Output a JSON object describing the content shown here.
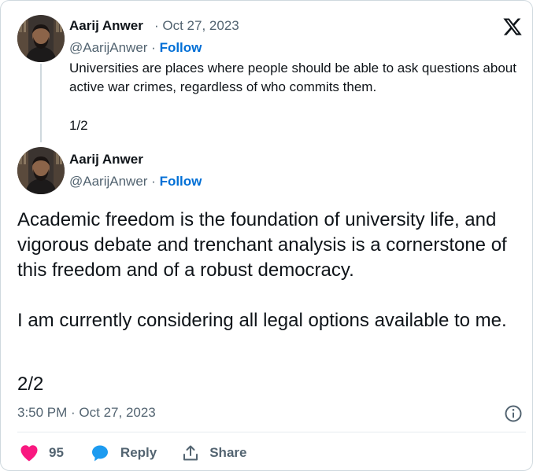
{
  "tweet1": {
    "author_name": "Aarij Anwer",
    "date": "· Oct 27, 2023",
    "handle": "@AarijAnwer",
    "separator": " · ",
    "follow_label": "Follow",
    "text": "Universities are places where people should be able to ask questions about active war crimes, regardless of who commits them.",
    "page": "1/2"
  },
  "tweet2": {
    "author_name": "Aarij Anwer",
    "handle": "@AarijAnwer",
    "separator": " · ",
    "follow_label": "Follow",
    "paragraph1": "Academic freedom is the foundation of university life, and vigorous debate and trenchant analysis is a cornerstone of this freedom and of a robust democracy.",
    "paragraph2": "I am currently considering all legal options available to me.",
    "page": "2/2",
    "timestamp": "3:50 PM · Oct 27, 2023"
  },
  "actions": {
    "like_count": "95",
    "reply_label": "Reply",
    "share_label": "Share"
  },
  "colors": {
    "accent": "#006fd6",
    "like": "#f91880",
    "reply": "#1d9bf0",
    "muted": "#536471"
  },
  "icons": {
    "brand": "x-logo-icon",
    "info": "info-icon",
    "like": "heart-icon",
    "reply": "speech-bubble-icon",
    "share": "share-upload-icon"
  }
}
